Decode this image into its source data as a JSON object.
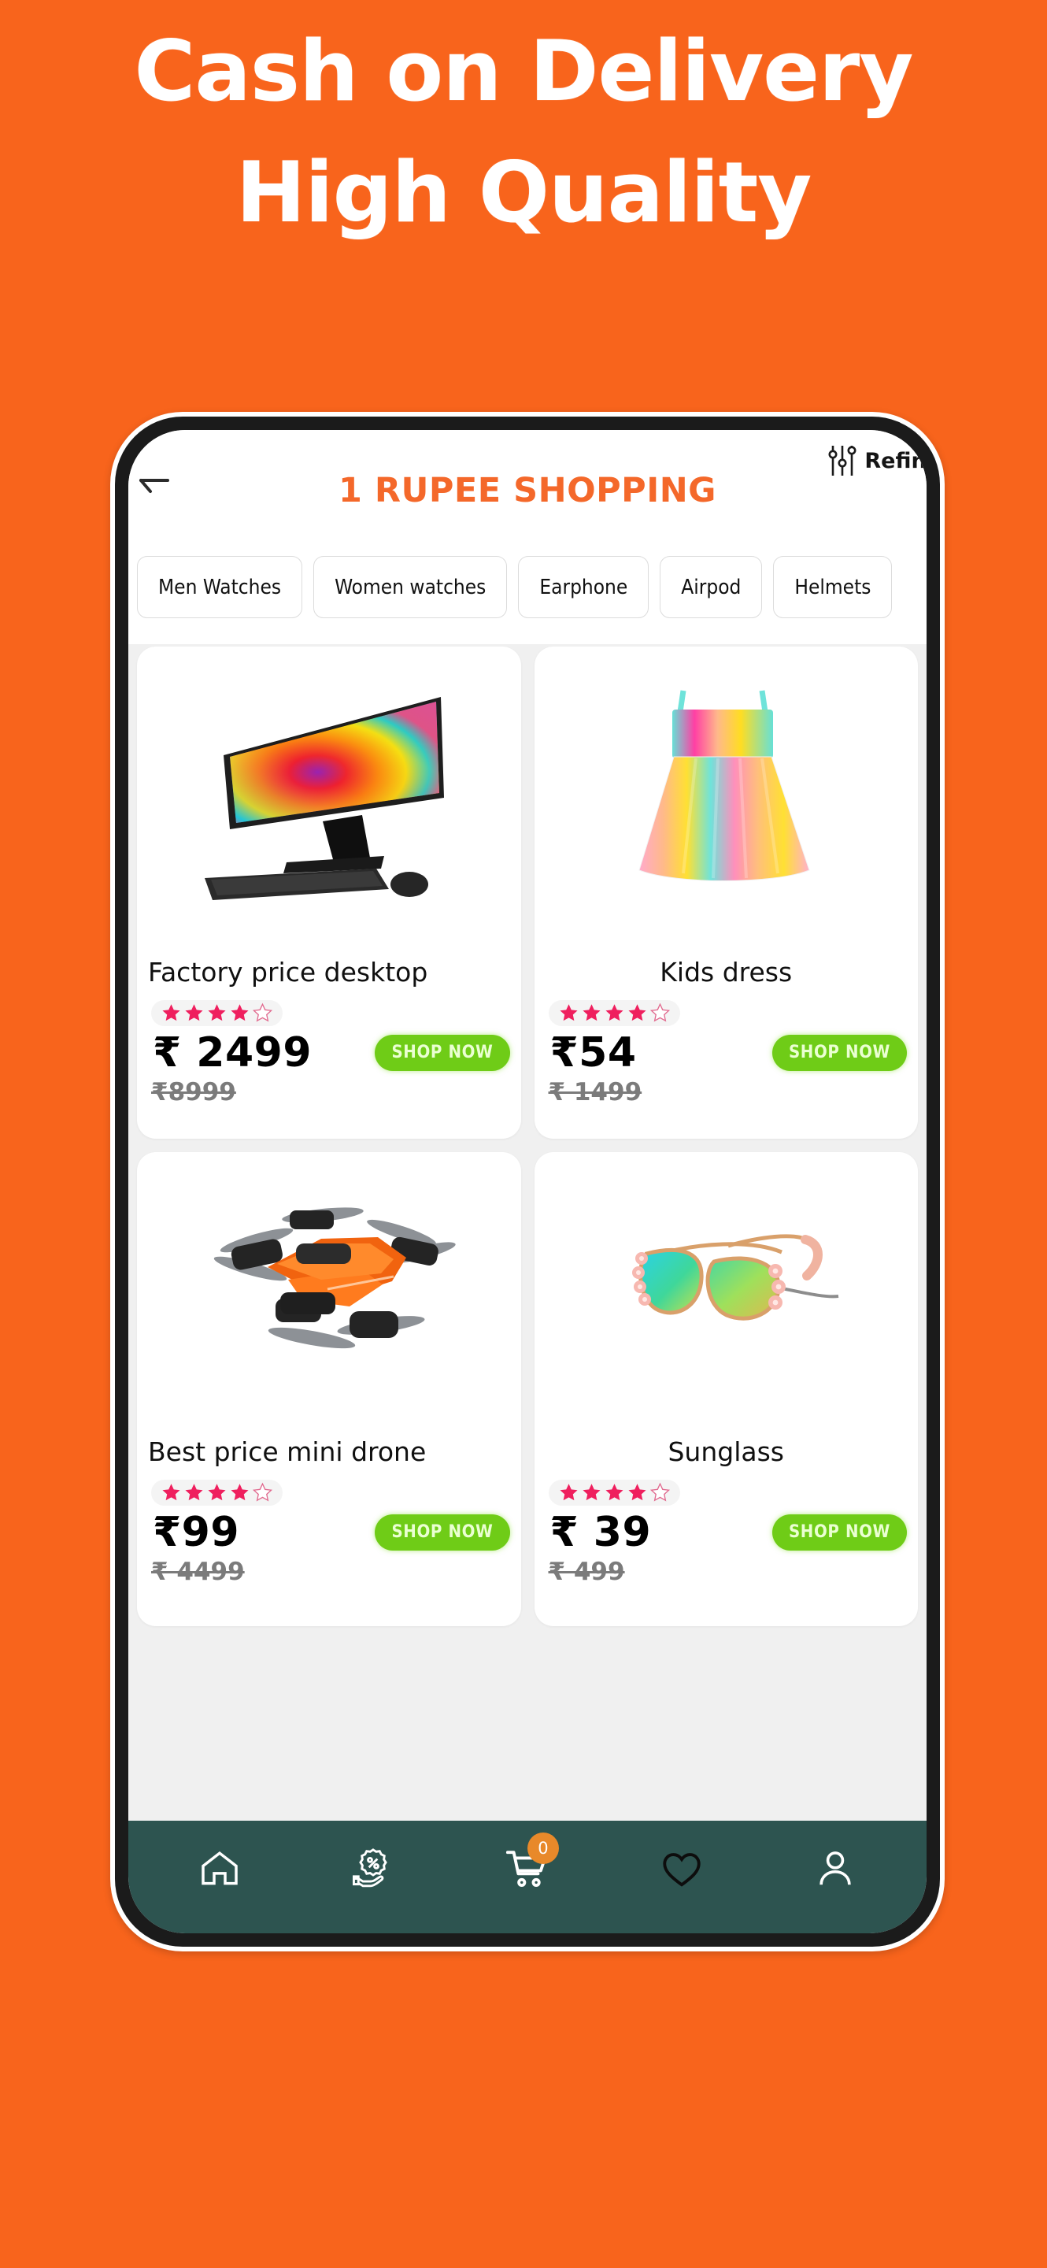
{
  "banner": {
    "line1": "Cash on Delivery",
    "line2": "High Quality",
    "background_color": "#f8641c",
    "text_color": "#ffffff"
  },
  "app": {
    "title": "1 RUPEE SHOPPING",
    "title_color": "#f4682a",
    "back_icon": "back-arrow-icon",
    "refine_label": "Refine",
    "refine_icon": "sliders-filter-icon"
  },
  "categories": [
    {
      "label": "Men Watches"
    },
    {
      "label": "Women watches"
    },
    {
      "label": "Earphone"
    },
    {
      "label": "Airpod"
    },
    {
      "label": "Helmets"
    }
  ],
  "products": [
    {
      "title": "Factory price desktop",
      "image": "desktop-monitor-image",
      "rating_filled": 4,
      "rating_total": 5,
      "price": "₹ 2499",
      "old_price": "₹8999",
      "cta": "SHOP NOW",
      "title_align": "left"
    },
    {
      "title": "Kids dress",
      "image": "kids-dress-image",
      "rating_filled": 4,
      "rating_total": 5,
      "price": "₹54",
      "old_price": "₹ 1499",
      "cta": "SHOP NOW",
      "title_align": "center"
    },
    {
      "title": "Best price mini drone",
      "image": "mini-drone-image",
      "rating_filled": 4,
      "rating_total": 5,
      "price": "₹99",
      "old_price": "₹ 4499",
      "cta": "SHOP NOW",
      "title_align": "left"
    },
    {
      "title": "Sunglass",
      "image": "sunglass-image",
      "rating_filled": 4,
      "rating_total": 5,
      "price": "₹ 39",
      "old_price": "₹ 499",
      "cta": "SHOP NOW",
      "title_align": "center"
    }
  ],
  "bottom_nav": {
    "background_color": "#2d5450",
    "items": [
      {
        "icon": "home-icon",
        "active": true
      },
      {
        "icon": "offers-hand-percent-icon",
        "active": false
      },
      {
        "icon": "shopping-cart-icon",
        "badge": "0",
        "active": false
      },
      {
        "icon": "heart-wishlist-icon",
        "active": false
      },
      {
        "icon": "user-profile-icon",
        "active": false
      }
    ]
  },
  "colors": {
    "brand_orange": "#f8641c",
    "title_orange": "#f4682a",
    "cta_green": "#6fcc17",
    "star_pink": "#ef1f5e",
    "nav_teal": "#2d5450",
    "badge_orange": "#e8892a"
  }
}
